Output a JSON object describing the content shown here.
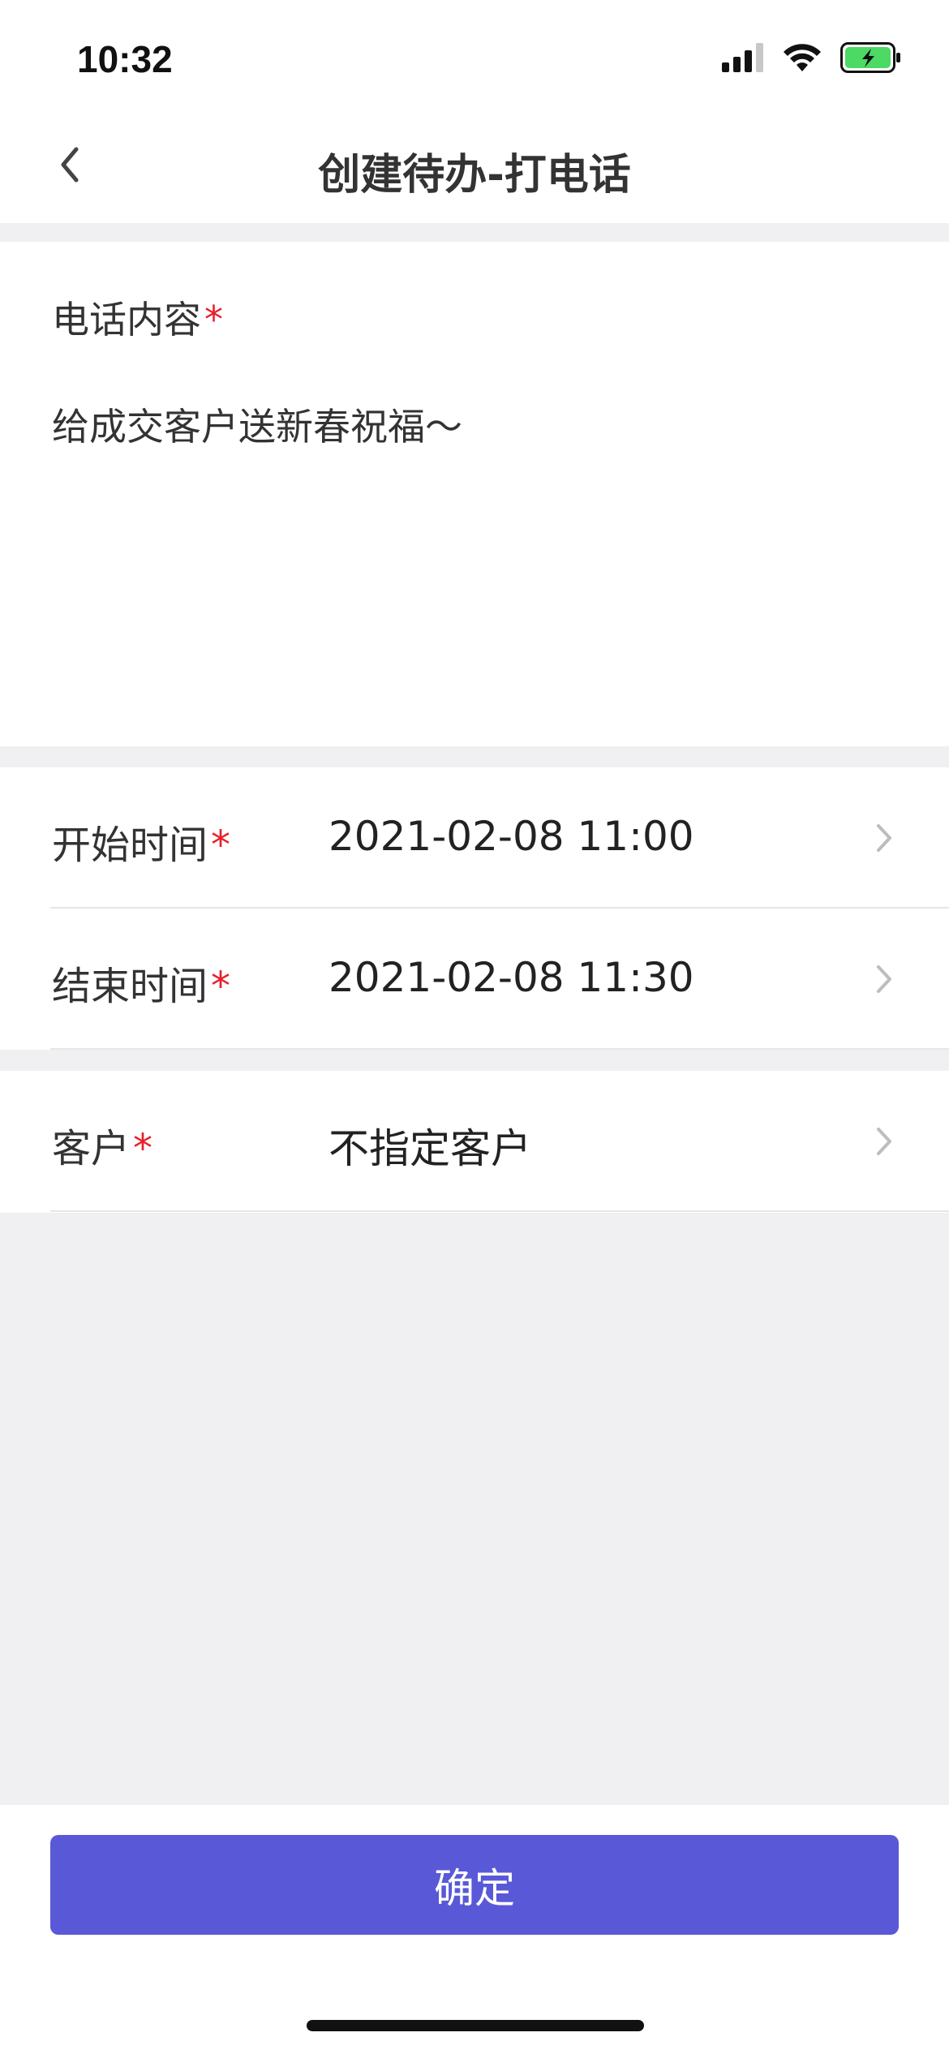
{
  "status_bar": {
    "time": "10:32",
    "icons": [
      "cellular-signal-icon",
      "wifi-icon",
      "battery-charging-icon"
    ],
    "battery_color": "#4cd964"
  },
  "nav": {
    "title": "创建待办-打电话",
    "back_icon": "chevron-left-icon"
  },
  "content": {
    "label": "电话内容",
    "required_mark": "*",
    "text": "给成交客户送新春祝福～"
  },
  "fields": {
    "start_time": {
      "label": "开始时间",
      "required_mark": "*",
      "value": "2021-02-08 11:00"
    },
    "end_time": {
      "label": "结束时间",
      "required_mark": "*",
      "value": "2021-02-08 11:30"
    },
    "customer": {
      "label": "客户",
      "required_mark": "*",
      "value": "不指定客户"
    }
  },
  "confirm": {
    "label": "确定"
  },
  "colors": {
    "accent": "#5959d8",
    "required": "#e8202a",
    "background": "#f0f0f2"
  }
}
